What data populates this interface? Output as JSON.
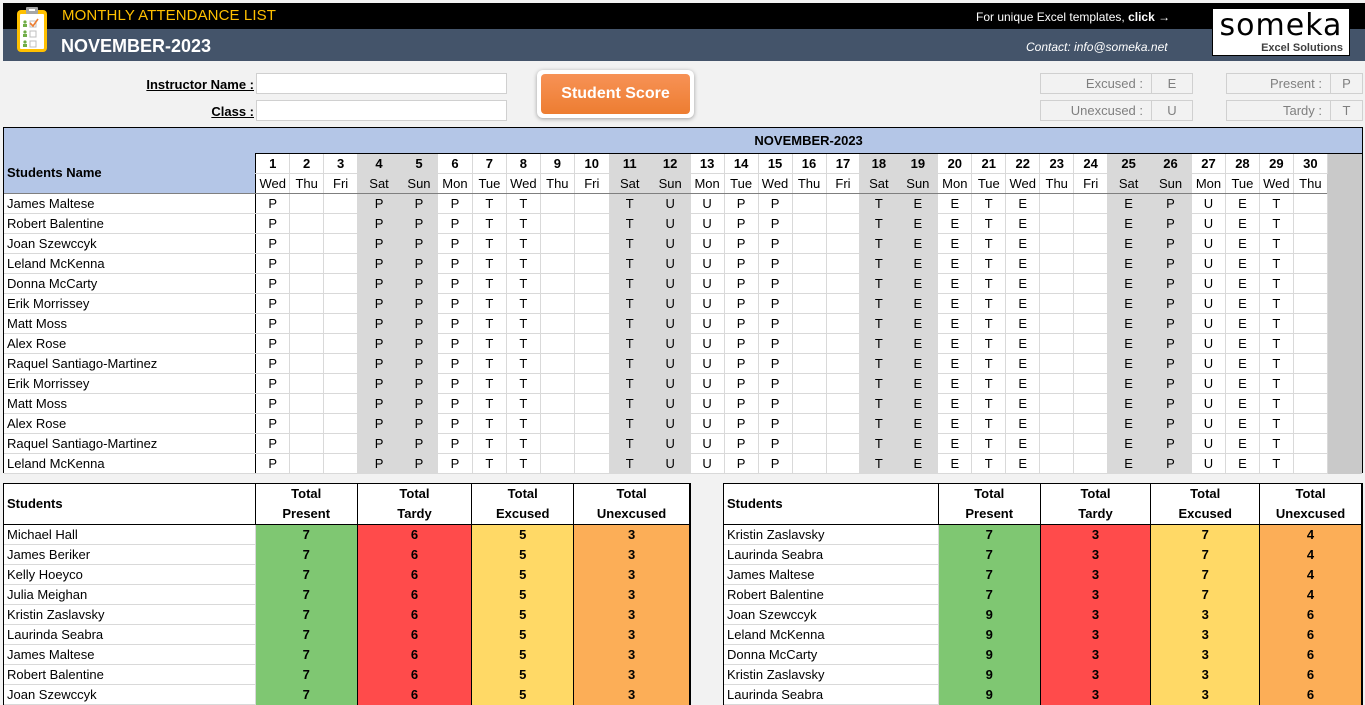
{
  "header": {
    "app_title": "MONTHLY ATTENDANCE LIST",
    "month_title": "NOVEMBER-2023",
    "promo_text": "For unique Excel templates, ",
    "promo_link": "click →",
    "contact": "Contact: info@someka.net",
    "logo_main": "someka",
    "logo_sub": "Excel Solutions",
    "app_icon": "clipboard-checklist-icon"
  },
  "form": {
    "instructor_label": "Instructor Name :",
    "instructor_value": "",
    "class_label": "Class :",
    "class_value": "",
    "score_button": "Student Score"
  },
  "legend": [
    {
      "label": "Excused :",
      "code": "E"
    },
    {
      "label": "Unexcused :",
      "code": "U"
    },
    {
      "label": "Present :",
      "code": "P"
    },
    {
      "label": "Tardy :",
      "code": "T"
    }
  ],
  "attendance": {
    "month_label": "NOVEMBER-2023",
    "students_header": "Students Name",
    "days": [
      {
        "num": "1",
        "name": "Wed"
      },
      {
        "num": "2",
        "name": "Thu"
      },
      {
        "num": "3",
        "name": "Fri"
      },
      {
        "num": "4",
        "name": "Sat"
      },
      {
        "num": "5",
        "name": "Sun"
      },
      {
        "num": "6",
        "name": "Mon"
      },
      {
        "num": "7",
        "name": "Tue"
      },
      {
        "num": "8",
        "name": "Wed"
      },
      {
        "num": "9",
        "name": "Thu"
      },
      {
        "num": "10",
        "name": "Fri"
      },
      {
        "num": "11",
        "name": "Sat"
      },
      {
        "num": "12",
        "name": "Sun"
      },
      {
        "num": "13",
        "name": "Mon"
      },
      {
        "num": "14",
        "name": "Tue"
      },
      {
        "num": "15",
        "name": "Wed"
      },
      {
        "num": "16",
        "name": "Thu"
      },
      {
        "num": "17",
        "name": "Fri"
      },
      {
        "num": "18",
        "name": "Sat"
      },
      {
        "num": "19",
        "name": "Sun"
      },
      {
        "num": "20",
        "name": "Mon"
      },
      {
        "num": "21",
        "name": "Tue"
      },
      {
        "num": "22",
        "name": "Wed"
      },
      {
        "num": "23",
        "name": "Thu"
      },
      {
        "num": "24",
        "name": "Fri"
      },
      {
        "num": "25",
        "name": "Sat"
      },
      {
        "num": "26",
        "name": "Sun"
      },
      {
        "num": "27",
        "name": "Mon"
      },
      {
        "num": "28",
        "name": "Tue"
      },
      {
        "num": "29",
        "name": "Wed"
      },
      {
        "num": "30",
        "name": "Thu"
      }
    ],
    "rows": [
      {
        "name": "James Maltese",
        "marks": [
          "P",
          "",
          "",
          "P",
          "P",
          "P",
          "T",
          "T",
          "",
          "",
          "T",
          "U",
          "U",
          "P",
          "P",
          "",
          "",
          "T",
          "E",
          "E",
          "T",
          "E",
          "",
          "",
          "E",
          "P",
          "U",
          "E",
          "T",
          ""
        ]
      },
      {
        "name": "Robert Balentine",
        "marks": [
          "P",
          "",
          "",
          "P",
          "P",
          "P",
          "T",
          "T",
          "",
          "",
          "T",
          "U",
          "U",
          "P",
          "P",
          "",
          "",
          "T",
          "E",
          "E",
          "T",
          "E",
          "",
          "",
          "E",
          "P",
          "U",
          "E",
          "T",
          ""
        ]
      },
      {
        "name": "Joan Szewccyk",
        "marks": [
          "P",
          "",
          "",
          "P",
          "P",
          "P",
          "T",
          "T",
          "",
          "",
          "T",
          "U",
          "U",
          "P",
          "P",
          "",
          "",
          "T",
          "E",
          "E",
          "T",
          "E",
          "",
          "",
          "E",
          "P",
          "U",
          "E",
          "T",
          ""
        ]
      },
      {
        "name": "Leland McKenna",
        "marks": [
          "P",
          "",
          "",
          "P",
          "P",
          "P",
          "T",
          "T",
          "",
          "",
          "T",
          "U",
          "U",
          "P",
          "P",
          "",
          "",
          "T",
          "E",
          "E",
          "T",
          "E",
          "",
          "",
          "E",
          "P",
          "U",
          "E",
          "T",
          ""
        ]
      },
      {
        "name": "Donna McCarty",
        "marks": [
          "P",
          "",
          "",
          "P",
          "P",
          "P",
          "T",
          "T",
          "",
          "",
          "T",
          "U",
          "U",
          "P",
          "P",
          "",
          "",
          "T",
          "E",
          "E",
          "T",
          "E",
          "",
          "",
          "E",
          "P",
          "U",
          "E",
          "T",
          ""
        ]
      },
      {
        "name": "Erik Morrissey",
        "marks": [
          "P",
          "",
          "",
          "P",
          "P",
          "P",
          "T",
          "T",
          "",
          "",
          "T",
          "U",
          "U",
          "P",
          "P",
          "",
          "",
          "T",
          "E",
          "E",
          "T",
          "E",
          "",
          "",
          "E",
          "P",
          "U",
          "E",
          "T",
          ""
        ]
      },
      {
        "name": "Matt Moss",
        "marks": [
          "P",
          "",
          "",
          "P",
          "P",
          "P",
          "T",
          "T",
          "",
          "",
          "T",
          "U",
          "U",
          "P",
          "P",
          "",
          "",
          "T",
          "E",
          "E",
          "T",
          "E",
          "",
          "",
          "E",
          "P",
          "U",
          "E",
          "T",
          ""
        ]
      },
      {
        "name": "Alex Rose",
        "marks": [
          "P",
          "",
          "",
          "P",
          "P",
          "P",
          "T",
          "T",
          "",
          "",
          "T",
          "U",
          "U",
          "P",
          "P",
          "",
          "",
          "T",
          "E",
          "E",
          "T",
          "E",
          "",
          "",
          "E",
          "P",
          "U",
          "E",
          "T",
          ""
        ]
      },
      {
        "name": "Raquel Santiago-Martinez",
        "marks": [
          "P",
          "",
          "",
          "P",
          "P",
          "P",
          "T",
          "T",
          "",
          "",
          "T",
          "U",
          "U",
          "P",
          "P",
          "",
          "",
          "T",
          "E",
          "E",
          "T",
          "E",
          "",
          "",
          "E",
          "P",
          "U",
          "E",
          "T",
          ""
        ]
      },
      {
        "name": "Erik Morrissey",
        "marks": [
          "P",
          "",
          "",
          "P",
          "P",
          "P",
          "T",
          "T",
          "",
          "",
          "T",
          "U",
          "U",
          "P",
          "P",
          "",
          "",
          "T",
          "E",
          "E",
          "T",
          "E",
          "",
          "",
          "E",
          "P",
          "U",
          "E",
          "T",
          ""
        ]
      },
      {
        "name": "Matt Moss",
        "marks": [
          "P",
          "",
          "",
          "P",
          "P",
          "P",
          "T",
          "T",
          "",
          "",
          "T",
          "U",
          "U",
          "P",
          "P",
          "",
          "",
          "T",
          "E",
          "E",
          "T",
          "E",
          "",
          "",
          "E",
          "P",
          "U",
          "E",
          "T",
          ""
        ]
      },
      {
        "name": "Alex Rose",
        "marks": [
          "P",
          "",
          "",
          "P",
          "P",
          "P",
          "T",
          "T",
          "",
          "",
          "T",
          "U",
          "U",
          "P",
          "P",
          "",
          "",
          "T",
          "E",
          "E",
          "T",
          "E",
          "",
          "",
          "E",
          "P",
          "U",
          "E",
          "T",
          ""
        ]
      },
      {
        "name": "Raquel Santiago-Martinez",
        "marks": [
          "P",
          "",
          "",
          "P",
          "P",
          "P",
          "T",
          "T",
          "",
          "",
          "T",
          "U",
          "U",
          "P",
          "P",
          "",
          "",
          "T",
          "E",
          "E",
          "T",
          "E",
          "",
          "",
          "E",
          "P",
          "U",
          "E",
          "T",
          ""
        ]
      },
      {
        "name": "Leland McKenna",
        "marks": [
          "P",
          "",
          "",
          "P",
          "P",
          "P",
          "T",
          "T",
          "",
          "",
          "T",
          "U",
          "U",
          "P",
          "P",
          "",
          "",
          "T",
          "E",
          "E",
          "T",
          "E",
          "",
          "",
          "E",
          "P",
          "U",
          "E",
          "T",
          ""
        ]
      }
    ]
  },
  "summary_headers": {
    "students": "Students",
    "present": [
      "Total",
      "Present"
    ],
    "tardy": [
      "Total",
      "Tardy"
    ],
    "excused": [
      "Total",
      "Excused"
    ],
    "unexcused": [
      "Total",
      "Unexcused"
    ]
  },
  "summary_colors": {
    "present": "#7fc772",
    "tardy": "#ff4b4b",
    "excused": "#ffd966",
    "unexcused": "#fcae57"
  },
  "summary_left": [
    {
      "name": "Michael Hall",
      "present": "7",
      "tardy": "6",
      "excused": "5",
      "unexcused": "3"
    },
    {
      "name": "James Beriker",
      "present": "7",
      "tardy": "6",
      "excused": "5",
      "unexcused": "3"
    },
    {
      "name": "Kelly Hoeyco",
      "present": "7",
      "tardy": "6",
      "excused": "5",
      "unexcused": "3"
    },
    {
      "name": "Julia Meighan",
      "present": "7",
      "tardy": "6",
      "excused": "5",
      "unexcused": "3"
    },
    {
      "name": "Kristin Zaslavsky",
      "present": "7",
      "tardy": "6",
      "excused": "5",
      "unexcused": "3"
    },
    {
      "name": "Laurinda Seabra",
      "present": "7",
      "tardy": "6",
      "excused": "5",
      "unexcused": "3"
    },
    {
      "name": "James Maltese",
      "present": "7",
      "tardy": "6",
      "excused": "5",
      "unexcused": "3"
    },
    {
      "name": "Robert Balentine",
      "present": "7",
      "tardy": "6",
      "excused": "5",
      "unexcused": "3"
    },
    {
      "name": "Joan Szewccyk",
      "present": "7",
      "tardy": "6",
      "excused": "5",
      "unexcused": "3"
    }
  ],
  "summary_right": [
    {
      "name": "Kristin Zaslavsky",
      "present": "7",
      "tardy": "3",
      "excused": "7",
      "unexcused": "4"
    },
    {
      "name": "Laurinda Seabra",
      "present": "7",
      "tardy": "3",
      "excused": "7",
      "unexcused": "4"
    },
    {
      "name": "James Maltese",
      "present": "7",
      "tardy": "3",
      "excused": "7",
      "unexcused": "4"
    },
    {
      "name": "Robert Balentine",
      "present": "7",
      "tardy": "3",
      "excused": "7",
      "unexcused": "4"
    },
    {
      "name": "Joan Szewccyk",
      "present": "9",
      "tardy": "3",
      "excused": "3",
      "unexcused": "6"
    },
    {
      "name": "Leland McKenna",
      "present": "9",
      "tardy": "3",
      "excused": "3",
      "unexcused": "6"
    },
    {
      "name": "Donna McCarty",
      "present": "9",
      "tardy": "3",
      "excused": "3",
      "unexcused": "6"
    },
    {
      "name": "Kristin Zaslavsky",
      "present": "9",
      "tardy": "3",
      "excused": "3",
      "unexcused": "6"
    },
    {
      "name": "Laurinda Seabra",
      "present": "9",
      "tardy": "3",
      "excused": "3",
      "unexcused": "6"
    }
  ]
}
